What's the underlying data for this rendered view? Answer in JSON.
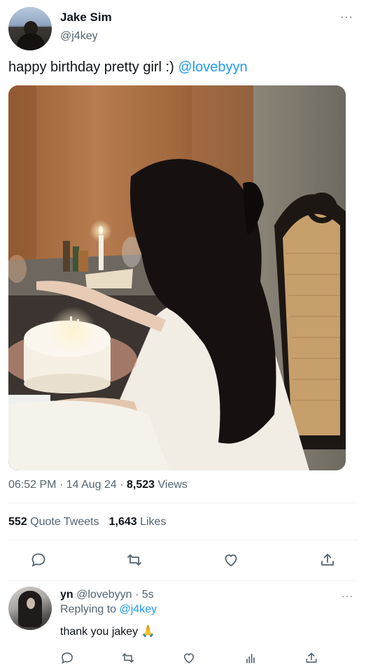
{
  "tweet": {
    "author_name": "Jake Sim",
    "author_handle": "@j4key",
    "text": "happy birthday pretty girl :) ",
    "mention": "@lovebyyn",
    "time": "06:52 PM",
    "date": "14 Aug 24",
    "views_count": "8,523",
    "views_label": "Views",
    "quote_count": "552",
    "quote_label": "Quote Tweets",
    "likes_count": "1,643",
    "likes_label": "Likes",
    "more_label": "···",
    "photo_icon": "photo-birthday-cake"
  },
  "actions": [
    "reply-icon",
    "retweet-icon",
    "like-icon",
    "share-icon"
  ],
  "reply": {
    "author_name": "yn",
    "author_handle": "@lovebyyn",
    "age": "5s",
    "replying_prefix": "Replying to ",
    "replying_to": "@j4key",
    "text": "thank you jakey 🙏",
    "more_label": "···"
  },
  "reply_actions": [
    "reply-icon",
    "retweet-icon",
    "like-icon",
    "analytics-icon",
    "share-icon"
  ],
  "colors": {
    "accent": "#1d9bf0",
    "text_primary": "#0f1419",
    "text_secondary": "#536471",
    "divider": "#eff3f4"
  }
}
